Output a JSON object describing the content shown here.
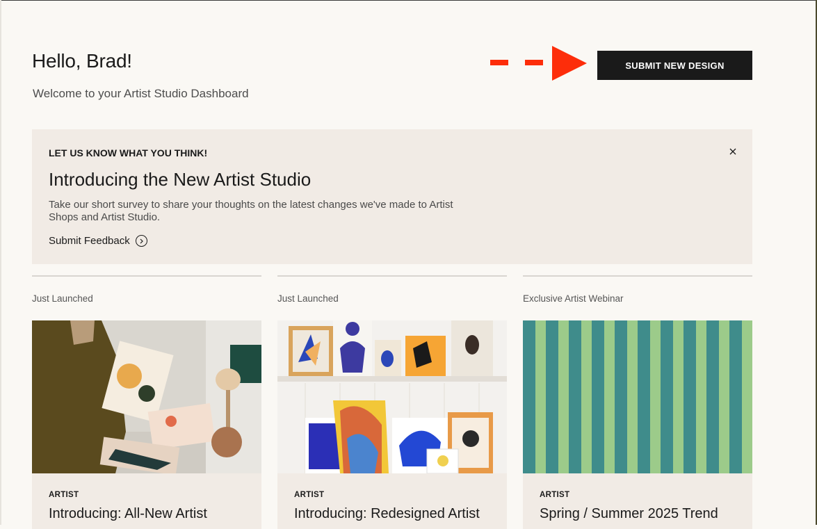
{
  "header": {
    "greeting": "Hello, Brad!",
    "subtitle": "Welcome to your Artist Studio Dashboard",
    "submit_label": "SUBMIT NEW DESIGN",
    "arrow_color": "#fd2d0a"
  },
  "banner": {
    "eyebrow": "LET US KNOW WHAT YOU THINK!",
    "title": "Introducing the New Artist Studio",
    "description": "Take our short survey to share your thoughts on the latest changes we've made to Artist Shops and Artist Studio.",
    "link_label": "Submit Feedback",
    "link_icon": "chevron-right-circle-icon",
    "close_icon": "close-icon"
  },
  "cards": [
    {
      "tag": "Just Launched",
      "kicker": "ARTIST",
      "title": "Introducing: All-New Artist"
    },
    {
      "tag": "Just Launched",
      "kicker": "ARTIST",
      "title": "Introducing: Redesigned Artist"
    },
    {
      "tag": "Exclusive Artist Webinar",
      "kicker": "ARTIST",
      "title": "Spring / Summer 2025 Trend"
    }
  ],
  "colors": {
    "background": "#faf8f4",
    "panel": "#f1ebe5",
    "button": "#1a1a1a",
    "stripe_teal": "#3f8c8b",
    "stripe_green": "#9ccb8a"
  }
}
